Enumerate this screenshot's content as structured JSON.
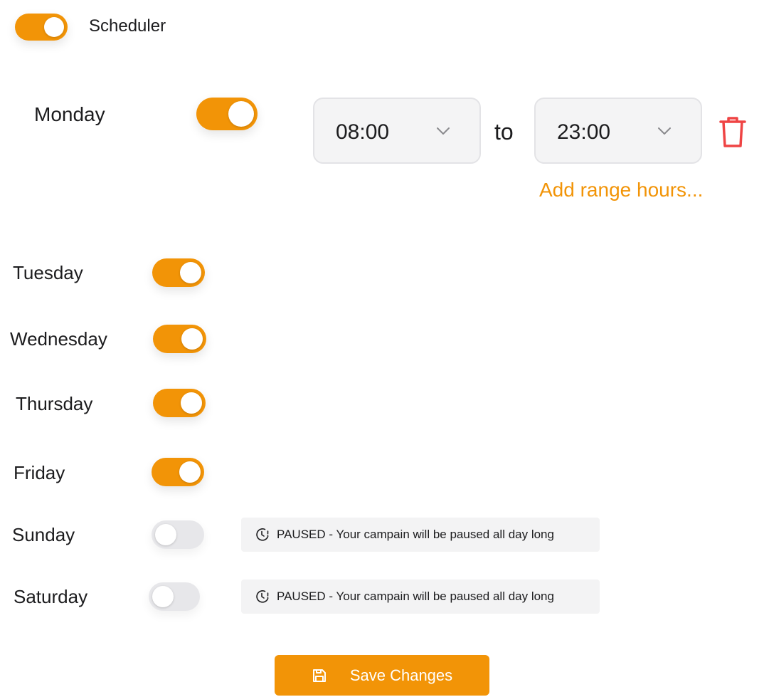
{
  "scheduler": {
    "label": "Scheduler",
    "enabled": true
  },
  "monday": {
    "label": "Monday",
    "enabled": true,
    "from": "08:00",
    "connector": "to",
    "to": "23:00",
    "add_range_label": "Add range hours..."
  },
  "days": [
    {
      "label": "Tuesday",
      "enabled": true
    },
    {
      "label": "Wednesday",
      "enabled": true
    },
    {
      "label": "Thursday",
      "enabled": true
    },
    {
      "label": "Friday",
      "enabled": true
    },
    {
      "label": "Sunday",
      "enabled": false
    },
    {
      "label": "Saturday",
      "enabled": false
    }
  ],
  "paused": {
    "status": "PAUSED",
    "message": " - Your campain will be paused all day long"
  },
  "save_button": {
    "label": "Save Changes"
  },
  "icons": {
    "trash": "trash-icon",
    "chevron": "chevron-down-icon",
    "clock": "clock-alert-icon",
    "save": "save-icon"
  },
  "colors": {
    "accent": "#f29407",
    "danger": "#ef4444",
    "toggle_off": "#e7e7ea",
    "select_bg": "#f4f4f5"
  }
}
